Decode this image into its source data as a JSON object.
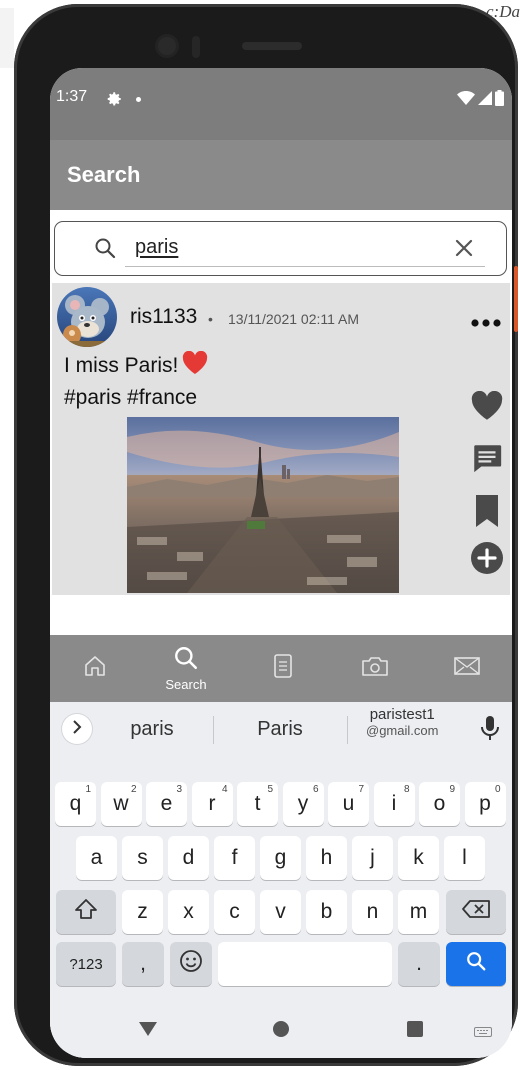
{
  "status": {
    "time": "1:37"
  },
  "appbar": {
    "title": "Search"
  },
  "search": {
    "value": "paris"
  },
  "post": {
    "username": "ris1133",
    "separator": "•",
    "timestamp": "13/11/2021 02:11 AM",
    "text_line1": "I miss Paris!",
    "text_line2": "#paris #france"
  },
  "bottom_nav": {
    "items": [
      {
        "name": "home",
        "label": ""
      },
      {
        "name": "search",
        "label": "Search"
      },
      {
        "name": "notes",
        "label": ""
      },
      {
        "name": "camera",
        "label": ""
      },
      {
        "name": "mail",
        "label": ""
      }
    ]
  },
  "keyboard": {
    "suggestions": [
      "paris",
      "Paris"
    ],
    "email_suggestion": {
      "line1": "paristest1",
      "line2": "@gmail.com"
    },
    "row1": [
      {
        "k": "q",
        "h": "1"
      },
      {
        "k": "w",
        "h": "2"
      },
      {
        "k": "e",
        "h": "3"
      },
      {
        "k": "r",
        "h": "4"
      },
      {
        "k": "t",
        "h": "5"
      },
      {
        "k": "y",
        "h": "6"
      },
      {
        "k": "u",
        "h": "7"
      },
      {
        "k": "i",
        "h": "8"
      },
      {
        "k": "o",
        "h": "9"
      },
      {
        "k": "p",
        "h": "0"
      }
    ],
    "row2": [
      "a",
      "s",
      "d",
      "f",
      "g",
      "h",
      "j",
      "k",
      "l"
    ],
    "row3": [
      "z",
      "x",
      "c",
      "v",
      "b",
      "n",
      "m"
    ],
    "symbols_label": "?123",
    "comma_label": ",",
    "period_label": "."
  },
  "colors": {
    "status_bar": "#7d7d7d",
    "app_bar": "#8a8a8a",
    "post_bg": "#e1e1e1",
    "keyboard_bg": "#eceef2",
    "search_key": "#1a73e8",
    "heart_emoji": "#e53935"
  },
  "icons": {
    "status": [
      "gear-icon",
      "wifi-icon",
      "signal-icon",
      "battery-icon"
    ],
    "post_actions": [
      "heart-icon",
      "comment-icon",
      "bookmark-icon",
      "add-circle-icon"
    ],
    "nav": [
      "home-icon",
      "search-icon",
      "notes-icon",
      "camera-icon",
      "mail-icon"
    ]
  }
}
